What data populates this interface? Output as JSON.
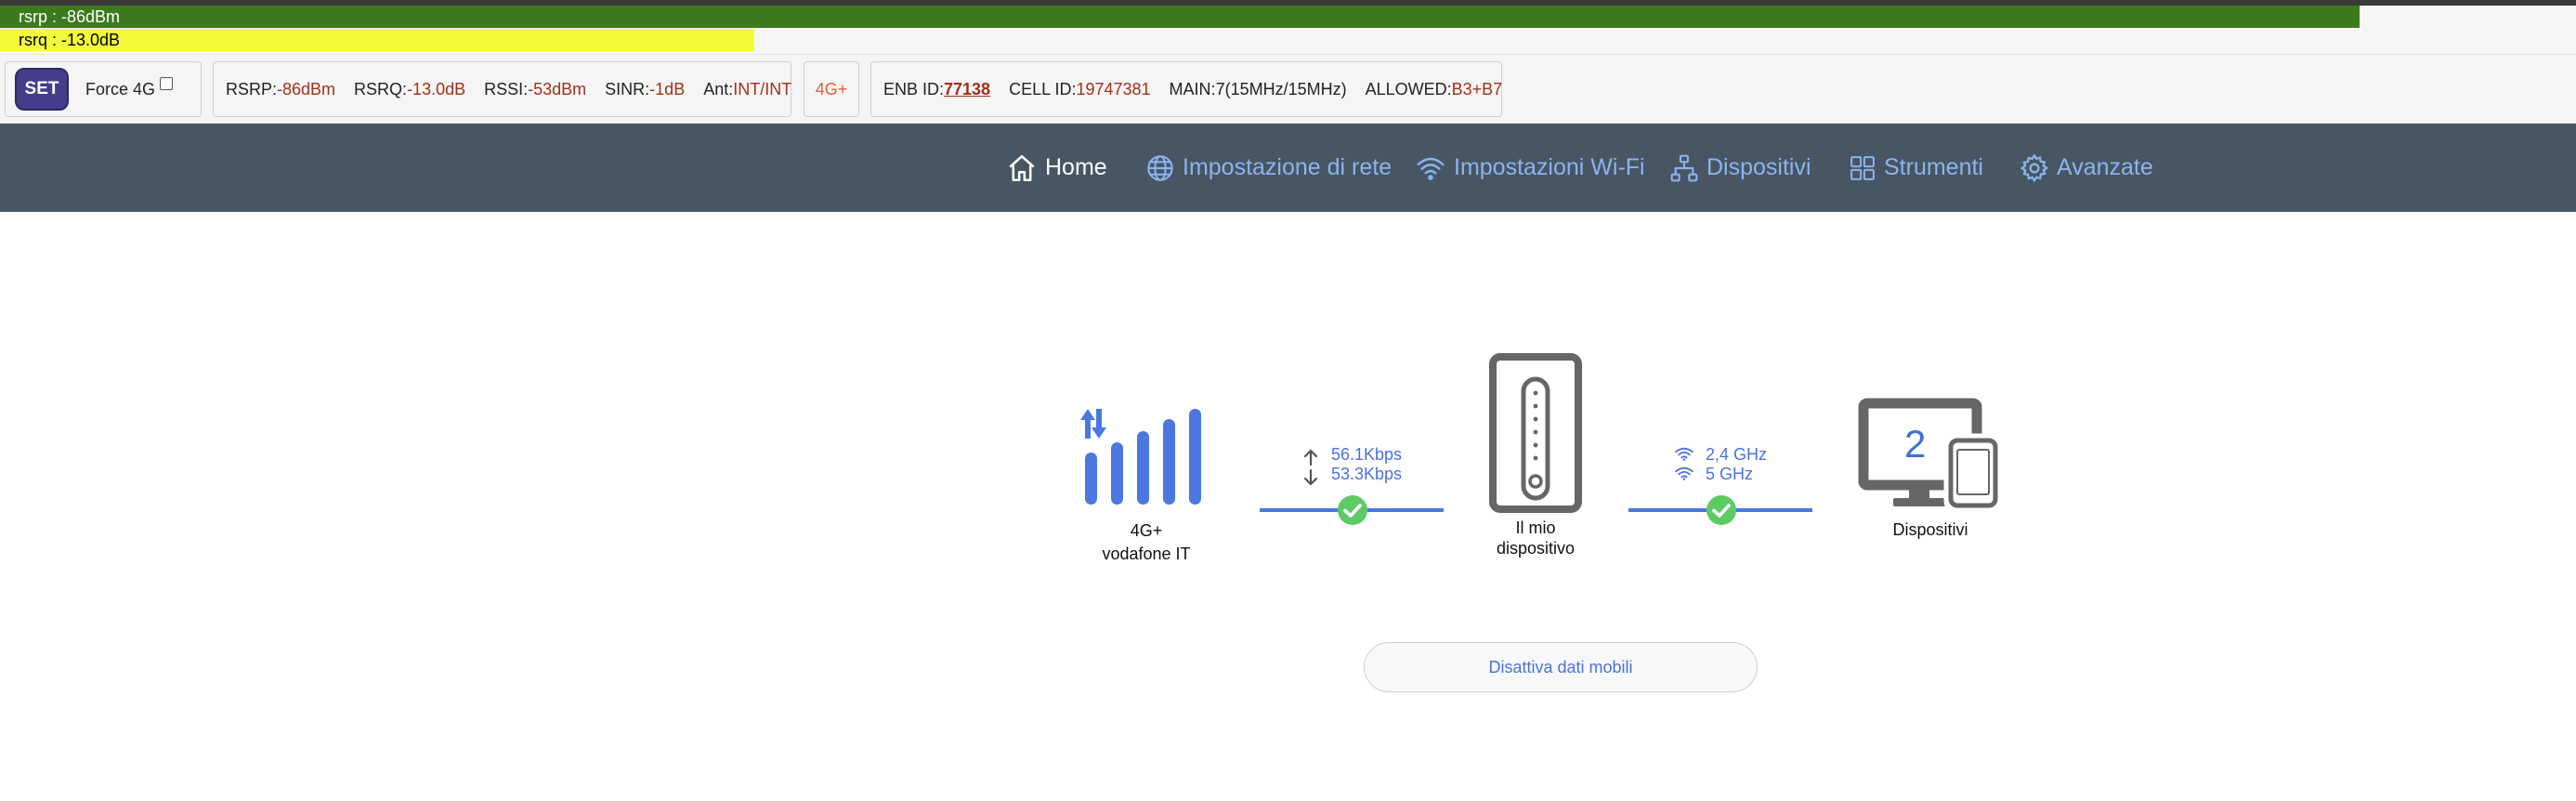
{
  "signal_bars": {
    "rsrp": {
      "label": "rsrp : -86dBm",
      "fill_fraction": 0.916,
      "color": "#3b7a1d"
    },
    "rsrq": {
      "label": "rsrq : -13.0dB",
      "fill_fraction": 0.293,
      "color": "#f3fa3a"
    }
  },
  "controls": {
    "set_label": "SET",
    "force_label": "Force 4G",
    "force_checked": false
  },
  "signal": {
    "rsrp_key": "RSRP:",
    "rsrp_val": "-86dBm",
    "rsrq_key": "RSRQ:",
    "rsrq_val": "-13.0dB",
    "rssi_key": "RSSI:",
    "rssi_val": "-53dBm",
    "sinr_key": "SINR:",
    "sinr_val": "-1dB",
    "ant_key": "Ant:",
    "ant_val": "INT/INT"
  },
  "network_badge": "4G+",
  "cell": {
    "enb_key": "ENB ID:",
    "enb_val": "77138",
    "cellid_key": "CELL ID:",
    "cellid_val": "19747381",
    "main_key": "MAIN:",
    "main_val": "7(15MHz/15MHz)",
    "allowed_key": "ALLOWED:",
    "allowed_val": "B3+B7"
  },
  "nav": {
    "items": [
      {
        "label": "Home",
        "icon": "home-icon",
        "active": true
      },
      {
        "label": "Impostazione di rete",
        "icon": "globe-icon",
        "active": false
      },
      {
        "label": "Impostazioni Wi-Fi",
        "icon": "wifi-icon",
        "active": false
      },
      {
        "label": "Dispositivi",
        "icon": "network-tree-icon",
        "active": false
      },
      {
        "label": "Strumenti",
        "icon": "tools-grid-icon",
        "active": false
      },
      {
        "label": "Avanzate",
        "icon": "gear-icon",
        "active": false
      }
    ]
  },
  "diagram": {
    "network_type": "4G+",
    "operator": "vodafone IT",
    "upload_speed": "56.1Kbps",
    "download_speed": "53.3Kbps",
    "device_line1": "Il mio",
    "device_line2": "dispositivo",
    "band_24": "2,4 GHz",
    "band_5": "5 GHz",
    "devices_count": "2",
    "devices_label": "Dispositivi"
  },
  "mobile_data_button": "Disattiva dati mobili",
  "colors": {
    "nav_bg": "#485563",
    "nav_link": "#8cb4ee",
    "accent_blue": "#4a78e0",
    "ok_green": "#5dcb63",
    "value_red": "#a0301a",
    "set_button": "#433d8b"
  }
}
